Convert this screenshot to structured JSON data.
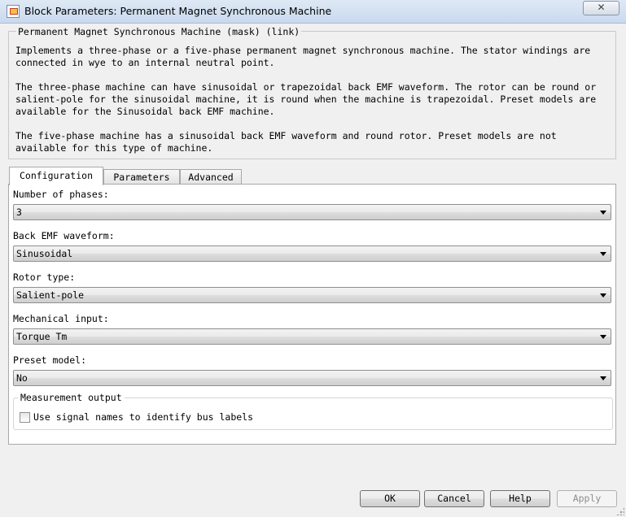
{
  "window": {
    "title": "Block Parameters: Permanent Magnet Synchronous Machine",
    "close_glyph": "✕",
    "icon": "simulink-block-icon"
  },
  "mask": {
    "title": "Permanent Magnet Synchronous Machine (mask) (link)",
    "paragraphs": [
      "Implements a three-phase or a five-phase permanent magnet synchronous machine. The stator windings are\nconnected in wye to an internal neutral point.",
      "The three-phase machine can have sinusoidal or trapezoidal back EMF waveform. The rotor can be round or\nsalient-pole for the sinusoidal machine, it is round when the machine is trapezoidal. Preset models are\navailable for the Sinusoidal back EMF machine.",
      "The five-phase machine has a sinusoidal back EMF waveform and round rotor. Preset models are not\navailable for this type of machine."
    ]
  },
  "tabs": [
    {
      "label": "Configuration",
      "active": true
    },
    {
      "label": "Parameters",
      "active": false
    },
    {
      "label": "Advanced",
      "active": false
    }
  ],
  "fields": [
    {
      "label": "Number of phases:",
      "value": "3"
    },
    {
      "label": "Back EMF waveform:",
      "value": "Sinusoidal"
    },
    {
      "label": "Rotor type:",
      "value": "Salient-pole"
    },
    {
      "label": "Mechanical input:",
      "value": "Torque Tm"
    },
    {
      "label": "Preset model:",
      "value": "No"
    }
  ],
  "measurement": {
    "title": "Measurement output",
    "checkbox_label": "Use signal names to identify bus labels",
    "checked": false
  },
  "buttons": {
    "ok": "OK",
    "cancel": "Cancel",
    "help": "Help",
    "apply": "Apply"
  }
}
